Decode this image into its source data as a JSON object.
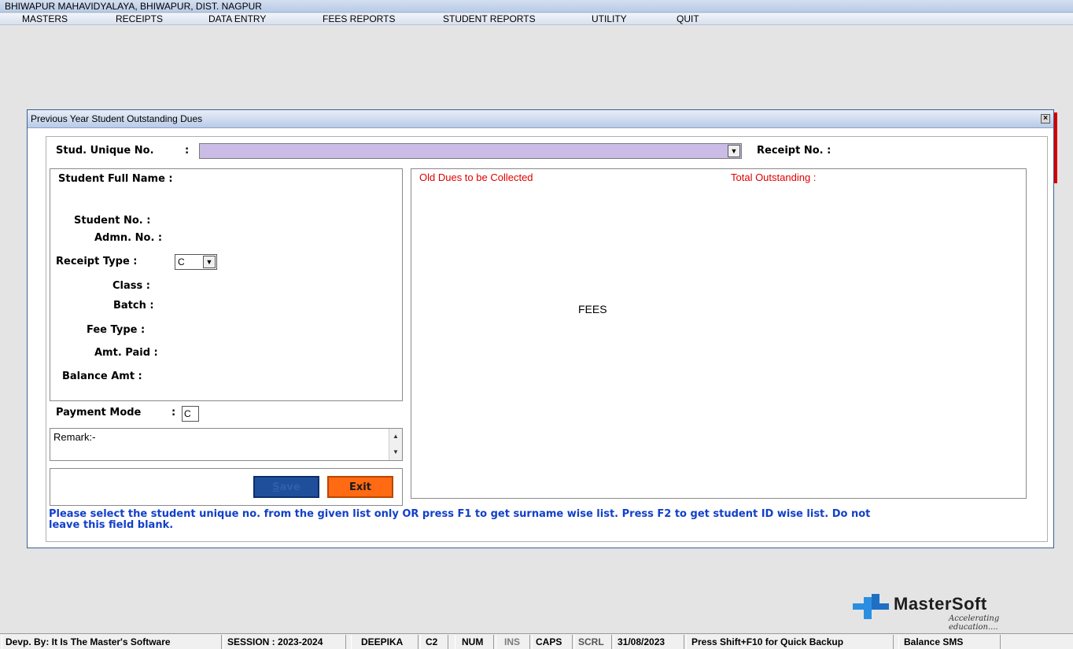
{
  "app": {
    "title": "BHIWAPUR MAHAVIDYALAYA, BHIWAPUR, DIST. NAGPUR"
  },
  "menu": [
    "MASTERS",
    "RECEIPTS",
    "DATA ENTRY",
    "FEES REPORTS",
    "STUDENT REPORTS",
    "UTILITY",
    "QUIT"
  ],
  "dialog": {
    "title": "Previous Year Student Outstanding Dues",
    "close_glyph": "×",
    "stud_unique_label": "Stud. Unique No.",
    "stud_unique_colon": ":",
    "stud_unique_value": "",
    "receipt_no_label": "Receipt No. :",
    "student_full_name_label": "Student Full Name :",
    "student_no_label": "Student No.  :",
    "admn_no_label": "Admn. No. :",
    "receipt_type_label": "Receipt Type  :",
    "receipt_type_value": "C",
    "class_label": "Class  :",
    "batch_label": "Batch :",
    "fee_type_label": "Fee Type  :",
    "amt_paid_label": "Amt. Paid  :",
    "balance_amt_label": "Balance Amt  :",
    "payment_mode_label": "Payment Mode",
    "payment_mode_colon": ":",
    "payment_mode_value": "C",
    "remark_value": "Remark:-",
    "save_label_first": "S",
    "save_label_rest": "ave",
    "exit_label": "Exit",
    "old_dues_label": "Old Dues to be Collected",
    "total_outstanding_label": "Total Outstanding :",
    "fees_label": "FEES",
    "hint_line1": "Please select the student unique no. from the given list only OR press F1 to get surname wise list. Press F2 to get student ID wise list. Do not",
    "hint_line2": "leave this field blank."
  },
  "logo": {
    "name": "MasterSoft",
    "tagline": "Accelerating education...."
  },
  "status": {
    "developer": "Devp. By: It Is The Master's Software",
    "session": "SESSION : 2023-2024",
    "user": "DEEPIKA",
    "code": "C2",
    "num": "NUM",
    "ins": "INS",
    "caps": "CAPS",
    "scrl": "SCRL",
    "date": "31/08/2023",
    "backup_hint": "Press Shift+F10 for Quick Backup",
    "sms": "Balance SMS"
  },
  "colors": {
    "combo_fill": "#cbbce6",
    "save_button": "#1f4f9a",
    "exit_button": "#ff6a13",
    "red_text": "#e00000",
    "hint_text": "#1240c8"
  }
}
